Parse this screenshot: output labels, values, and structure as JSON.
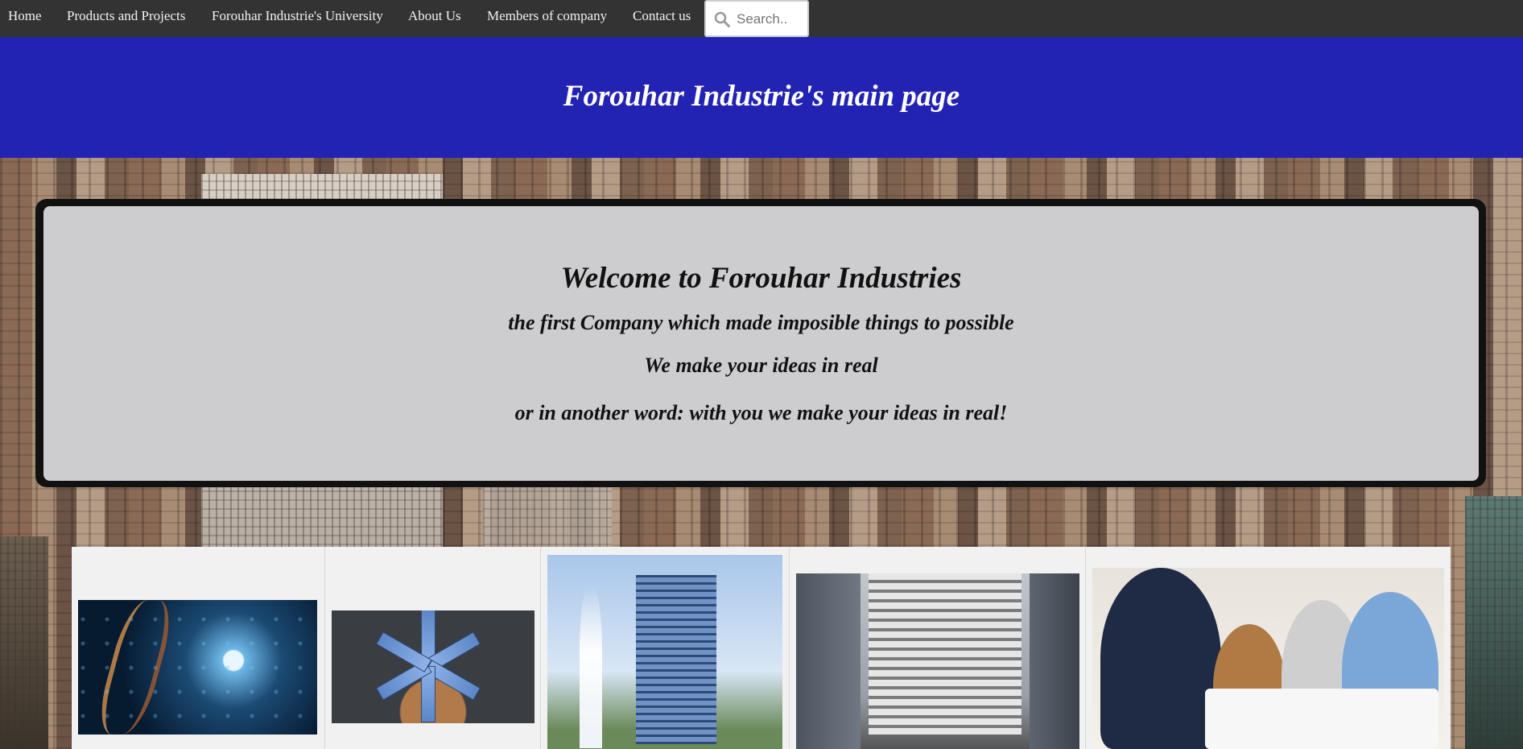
{
  "nav": {
    "items": [
      {
        "label": "Home"
      },
      {
        "label": "Products and Projects"
      },
      {
        "label": "Forouhar Industrie's University"
      },
      {
        "label": "About Us"
      },
      {
        "label": "Members of company"
      },
      {
        "label": "Contact us"
      }
    ],
    "search": {
      "placeholder": "Search..",
      "icon": "search-icon"
    }
  },
  "banner": {
    "title": "Forouhar Industrie's main page"
  },
  "welcome": {
    "title": "Welcome to Forouhar Industries",
    "line1": "the first Company which made imposible things to possible",
    "line2": "We make your ideas in real",
    "line3": "or in another word: with you we make your ideas in real!"
  },
  "gallery": {
    "images": [
      {
        "name": "dna-robot-image"
      },
      {
        "name": "solar-fan-image"
      },
      {
        "name": "tower-fountain-image"
      },
      {
        "name": "city-street-image"
      },
      {
        "name": "team-meeting-image"
      }
    ]
  },
  "colors": {
    "nav_bg": "#333333",
    "banner_bg": "#2323b3",
    "panel_frame": "#111111"
  }
}
